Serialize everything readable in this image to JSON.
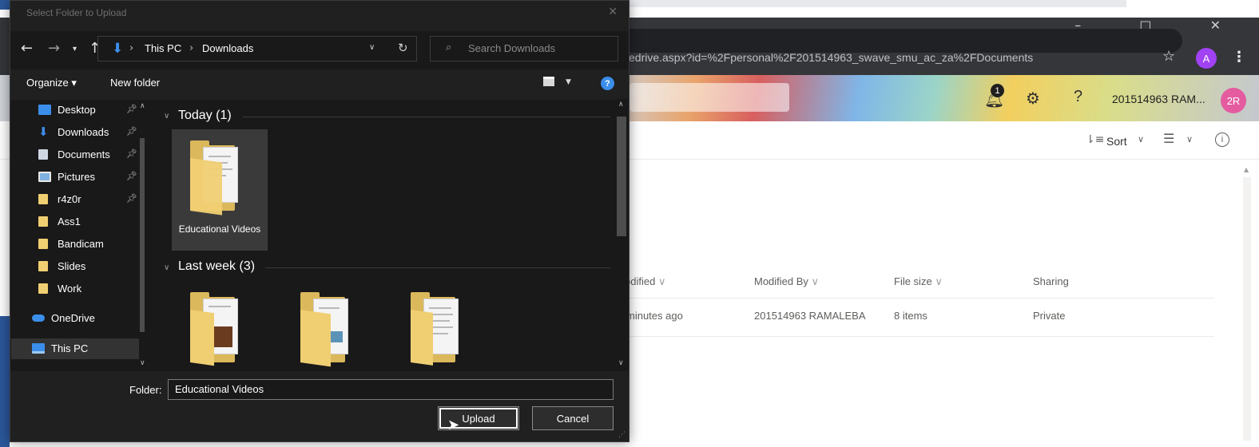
{
  "browser": {
    "url": "edrive.aspx?id=%2Fpersonal%2F201514963_swave_smu_ac_za%2FDocuments",
    "profile_initial": "A",
    "window_controls": "–  □  ✕"
  },
  "suitebar": {
    "notification_count": "1",
    "help_label": "?",
    "user_name": "201514963 RAM...",
    "user_initials": "2R"
  },
  "commandbar": {
    "sort_label": "Sort",
    "info_label": "i"
  },
  "list": {
    "columns": [
      "odified",
      "Modified By",
      "File size",
      "Sharing"
    ],
    "row": {
      "modified": "minutes ago",
      "modified_by": "201514963 RAMALEBA",
      "file_size": "8 items",
      "sharing": "Private"
    }
  },
  "dialog": {
    "title": "Select Folder to Upload",
    "breadcrumb": [
      "This PC",
      "Downloads"
    ],
    "search_placeholder": "Search Downloads",
    "toolbar": {
      "organize": "Organize ▾",
      "new_folder": "New folder",
      "help": "?"
    },
    "nav_items": [
      {
        "label": "Desktop",
        "icon": "desktop-icon",
        "pinned": true
      },
      {
        "label": "Downloads",
        "icon": "downloads-icon",
        "pinned": true
      },
      {
        "label": "Documents",
        "icon": "documents-icon",
        "pinned": true
      },
      {
        "label": "Pictures",
        "icon": "pictures-icon",
        "pinned": true
      },
      {
        "label": "r4z0r",
        "icon": "folder-icon",
        "pinned": true
      },
      {
        "label": "Ass1",
        "icon": "folder-icon",
        "pinned": false
      },
      {
        "label": "Bandicam",
        "icon": "folder-icon",
        "pinned": false
      },
      {
        "label": "Slides",
        "icon": "folder-icon",
        "pinned": false
      },
      {
        "label": "Work",
        "icon": "folder-icon",
        "pinned": false
      },
      {
        "label": "OneDrive",
        "icon": "onedrive-icon",
        "pinned": false
      },
      {
        "label": "This PC",
        "icon": "this-pc-icon",
        "pinned": false,
        "selected": true
      }
    ],
    "groups": [
      {
        "label": "Today (1)",
        "items": [
          {
            "name": "Educational Videos",
            "selected": true
          }
        ]
      },
      {
        "label": "Last week (3)",
        "items": [
          {
            "name": ""
          },
          {
            "name": ""
          },
          {
            "name": ""
          }
        ]
      }
    ],
    "folder_label": "Folder:",
    "folder_value": "Educational Videos",
    "upload_label": "Upload",
    "cancel_label": "Cancel"
  },
  "colors": {
    "dialog_bg": "#191919",
    "accent_blue": "#3b8eea",
    "folder_yellow": "#f0cf72"
  }
}
